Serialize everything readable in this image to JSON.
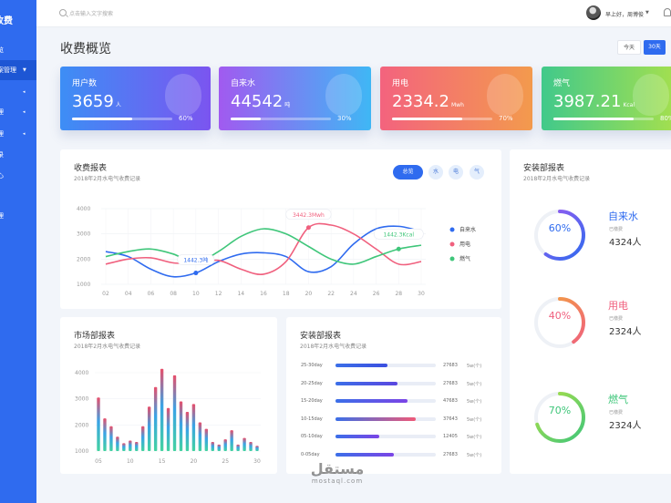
{
  "sidebar": {
    "logo": "收费",
    "items": [
      {
        "label": "览",
        "caret": ""
      },
      {
        "label": "案管理",
        "caret": "▼"
      },
      {
        "label": "",
        "caret": "◂"
      },
      {
        "label": "理",
        "caret": "◂"
      },
      {
        "label": "理",
        "caret": "◂"
      },
      {
        "label": "录",
        "caret": ""
      },
      {
        "label": "心",
        "caret": ""
      },
      {
        "label": "理",
        "caret": ""
      }
    ]
  },
  "topbar": {
    "search_placeholder": "点击输入文字搜索",
    "greeting": "早上好，周博俊",
    "caret": "▼"
  },
  "page_title": "收费概览",
  "range": {
    "today": "今天",
    "days30": "30天"
  },
  "stats": [
    {
      "label": "用户数",
      "value": "3659",
      "unit": "人",
      "percent": 60,
      "percent_text": "60%"
    },
    {
      "label": "自来水",
      "value": "44542",
      "unit": "吨",
      "percent": 30,
      "percent_text": "30%"
    },
    {
      "label": "用电",
      "value": "2334.2",
      "unit": "Mwh",
      "percent": 70,
      "percent_text": "70%"
    },
    {
      "label": "燃气",
      "value": "3987.21",
      "unit": "Kcal",
      "percent": 80,
      "percent_text": "80%"
    }
  ],
  "fee_card": {
    "title": "收费报表",
    "subtitle": "2018年2月水电气收费记录",
    "tabs": [
      "总览",
      "水",
      "电",
      "气"
    ],
    "legend": [
      {
        "name": "自来水",
        "color": "#2f6bef"
      },
      {
        "name": "用电",
        "color": "#f0607e"
      },
      {
        "name": "燃气",
        "color": "#3fc67a"
      }
    ],
    "callouts": [
      {
        "text": "3442.3Mwh",
        "color": "#f0607e"
      },
      {
        "text": "1442.3吨",
        "color": "#2f6bef"
      },
      {
        "text": "1442.3Kcal",
        "color": "#3fc67a"
      }
    ]
  },
  "install_right": {
    "title": "安装部报表",
    "subtitle": "2018年2月水电气收费记录",
    "rings": [
      {
        "percent": 60,
        "percent_text": "60%",
        "label": "自来水",
        "sub": "已缴费",
        "count": "4324人",
        "color": "#2f6bef",
        "color2": "#a15af0"
      },
      {
        "percent": 40,
        "percent_text": "40%",
        "label": "用电",
        "sub": "已缴费",
        "count": "2324人",
        "color": "#f0607e",
        "color2": "#f3a53c"
      },
      {
        "percent": 70,
        "percent_text": "70%",
        "label": "燃气",
        "sub": "已缴费",
        "count": "2324人",
        "color": "#3fc67a",
        "color2": "#b2e045"
      }
    ]
  },
  "market_card": {
    "title": "市场部报表",
    "subtitle": "2018年2月水电气收费记录"
  },
  "install_bottom": {
    "title": "安装部报表",
    "subtitle": "2018年2月水电气收费记录",
    "rows": [
      {
        "label": "25-30day",
        "percent": 52,
        "num": "27683",
        "unit": "5w(个)",
        "color": "#3b4fe0"
      },
      {
        "label": "20-25day",
        "percent": 62,
        "num": "27683",
        "unit": "5w(个)",
        "color": "#5a47e0"
      },
      {
        "label": "15-20day",
        "percent": 72,
        "num": "47683",
        "unit": "5w(个)",
        "color": "#7b44e6"
      },
      {
        "label": "10-15day",
        "percent": 80,
        "num": "37643",
        "unit": "5w(个)",
        "color": "#ef5a78"
      },
      {
        "label": "05-10day",
        "percent": 44,
        "num": "12405",
        "unit": "5w(个)",
        "color": "#7b44e6"
      },
      {
        "label": "0-05day",
        "percent": 58,
        "num": "27683",
        "unit": "5w(个)",
        "color": "#7b44e6"
      }
    ]
  },
  "watermark": {
    "arabic": "مستقل",
    "latin": "mostaql.com"
  },
  "chart_data": [
    {
      "type": "line",
      "title": "收费报表",
      "x": [
        "02",
        "04",
        "06",
        "08",
        "10",
        "12",
        "14",
        "16",
        "18",
        "20",
        "22",
        "24",
        "26",
        "28",
        "30"
      ],
      "ylim": [
        1000,
        4000
      ],
      "y_ticks": [
        "4000",
        "3000",
        "2000",
        "1000"
      ],
      "series": [
        {
          "name": "自来水",
          "values": [
            2300,
            2100,
            1600,
            1300,
            1450,
            1900,
            2200,
            2250,
            2100,
            1500,
            1700,
            2600,
            3200,
            3300,
            3100
          ]
        },
        {
          "name": "用电",
          "values": [
            1800,
            2000,
            2050,
            1850,
            1850,
            1950,
            1600,
            1400,
            1900,
            3250,
            3350,
            3000,
            2400,
            1800,
            1900
          ]
        },
        {
          "name": "燃气",
          "values": [
            2100,
            2300,
            2400,
            2200,
            1850,
            2300,
            2900,
            3200,
            3000,
            2500,
            2000,
            1800,
            2100,
            2400,
            2550
          ]
        }
      ],
      "grid": true,
      "legend": "right"
    },
    {
      "type": "bar",
      "title": "市场部报表",
      "x_ticks": [
        "05",
        "10",
        "15",
        "20",
        "25",
        "30"
      ],
      "y_ticks": [
        "4000",
        "3000",
        "2000",
        "1000"
      ],
      "ylim": [
        1000,
        4000
      ],
      "values": [
        3050,
        2250,
        1950,
        1550,
        1300,
        1400,
        1350,
        1950,
        2700,
        3450,
        4150,
        2650,
        3900,
        2900,
        2500,
        2800,
        2100,
        1850,
        1350,
        1250,
        1450,
        1800,
        1250,
        1500,
        1350,
        1200
      ],
      "grid": true
    }
  ]
}
